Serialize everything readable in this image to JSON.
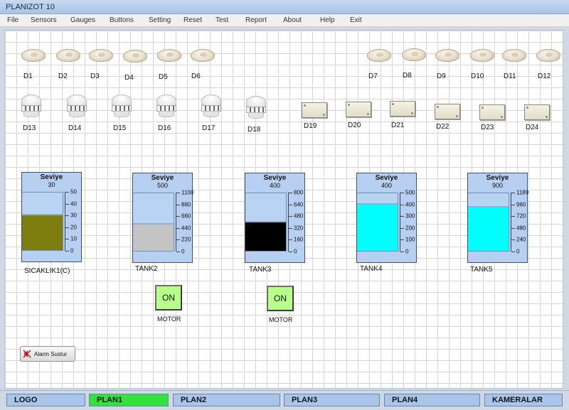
{
  "window": {
    "title": "PLANIZOT 10"
  },
  "menu": [
    "File",
    "Sensors",
    "Gauges",
    "Buttons",
    "Setting",
    "Reset",
    "Test",
    "Report",
    "About",
    "Help",
    "Exit"
  ],
  "detectors_dome": [
    "D1",
    "D2",
    "D3",
    "D4",
    "D5",
    "D6",
    "D7",
    "D8",
    "D9",
    "D10",
    "D11",
    "D12"
  ],
  "detectors_smoke": [
    "D13",
    "D14",
    "D15",
    "D16",
    "D17",
    "D18"
  ],
  "detectors_box": [
    "D19",
    "D20",
    "D21",
    "D22",
    "D23",
    "D24"
  ],
  "tanks": [
    {
      "header": "Seviye",
      "value": "30",
      "max": 50,
      "level": 30,
      "name": "SICAKLIK1(C)",
      "fill_color": "#7d7d10",
      "scale": [
        "50",
        "40",
        "30",
        "20",
        "10",
        "0"
      ]
    },
    {
      "header": "Seviye",
      "value": "500",
      "max": 1100,
      "level": 500,
      "name": "TANK2",
      "fill_color": "#c4c4c4",
      "scale": [
        "1100",
        "880",
        "660",
        "440",
        "220",
        "0"
      ]
    },
    {
      "header": "Seviye",
      "value": "400",
      "max": 800,
      "level": 400,
      "name": "TANK3",
      "fill_color": "#000000",
      "scale": [
        "800",
        "640",
        "480",
        "320",
        "160",
        "0"
      ]
    },
    {
      "header": "Seviye",
      "value": "400",
      "max": 500,
      "level": 400,
      "name": "TANK4",
      "fill_color": "#00ffff",
      "scale": [
        "500",
        "400",
        "300",
        "200",
        "100",
        "0"
      ]
    },
    {
      "header": "Seviye",
      "value": "900",
      "max": 1189,
      "level": 900,
      "name": "TANK5",
      "fill_color": "#00ffff",
      "scale": [
        "1189",
        "960",
        "720",
        "480",
        "240",
        "0"
      ]
    }
  ],
  "motors": [
    {
      "state": "ON",
      "label": "MOTOR"
    },
    {
      "state": "ON",
      "label": "MOTOR"
    }
  ],
  "alarm_button": {
    "label": "Alarm Sustur"
  },
  "tabs": [
    {
      "label": "LOGO",
      "active": false
    },
    {
      "label": "PLAN1",
      "active": true
    },
    {
      "label": "PLAN2",
      "active": false
    },
    {
      "label": "PLAN3",
      "active": false
    },
    {
      "label": "PLAN4",
      "active": false
    },
    {
      "label": "KAMERALAR",
      "active": false
    }
  ]
}
